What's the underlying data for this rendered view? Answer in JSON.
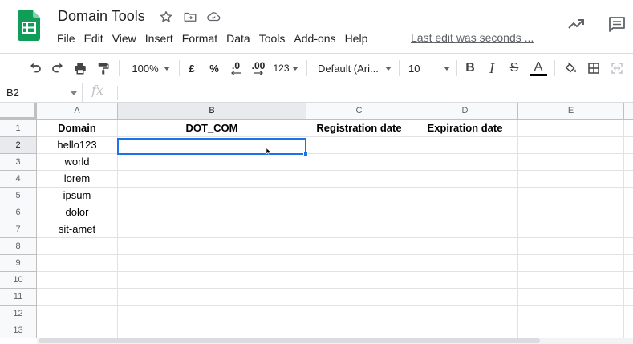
{
  "app": {
    "doc_title": "Domain Tools",
    "last_edit": "Last edit was seconds ...",
    "menu": [
      "File",
      "Edit",
      "View",
      "Insert",
      "Format",
      "Data",
      "Tools",
      "Add-ons",
      "Help"
    ]
  },
  "toolbar": {
    "zoom": "100%",
    "currency": "£",
    "percent": "%",
    "decrease_decimals": ".0",
    "increase_decimals": ".00",
    "more_formats": "123",
    "font": "Default (Ari...",
    "font_size": "10",
    "bold": "B",
    "italic": "I",
    "strikethrough": "S",
    "text_color_letter": "A"
  },
  "formula_bar": {
    "cell_ref": "B2",
    "fx": "fx",
    "content": ""
  },
  "sheet": {
    "columns": [
      "A",
      "B",
      "C",
      "D",
      "E"
    ],
    "rows": [
      "1",
      "2",
      "3",
      "4",
      "5",
      "6",
      "7",
      "8",
      "9",
      "10",
      "11",
      "12",
      "13"
    ],
    "cells": {
      "A1": "Domain",
      "B1": "DOT_COM",
      "C1": "Registration date",
      "D1": "Expiration date",
      "A2": "hello123",
      "A3": "world",
      "A4": "lorem",
      "A5": "ipsum",
      "A6": "dolor",
      "A7": "sit-amet"
    },
    "selected_cell": "B2"
  },
  "colors": {
    "selection": "#1a73e8",
    "sheets_green": "#0f9d58",
    "header_bg": "#f8f9fa"
  },
  "icons": {
    "logo": "google-sheets-logo",
    "star": "star-icon",
    "move": "move-to-folder-icon",
    "cloud": "cloud-saved-icon",
    "trend": "trending-up-icon",
    "comments": "comment-icon"
  }
}
